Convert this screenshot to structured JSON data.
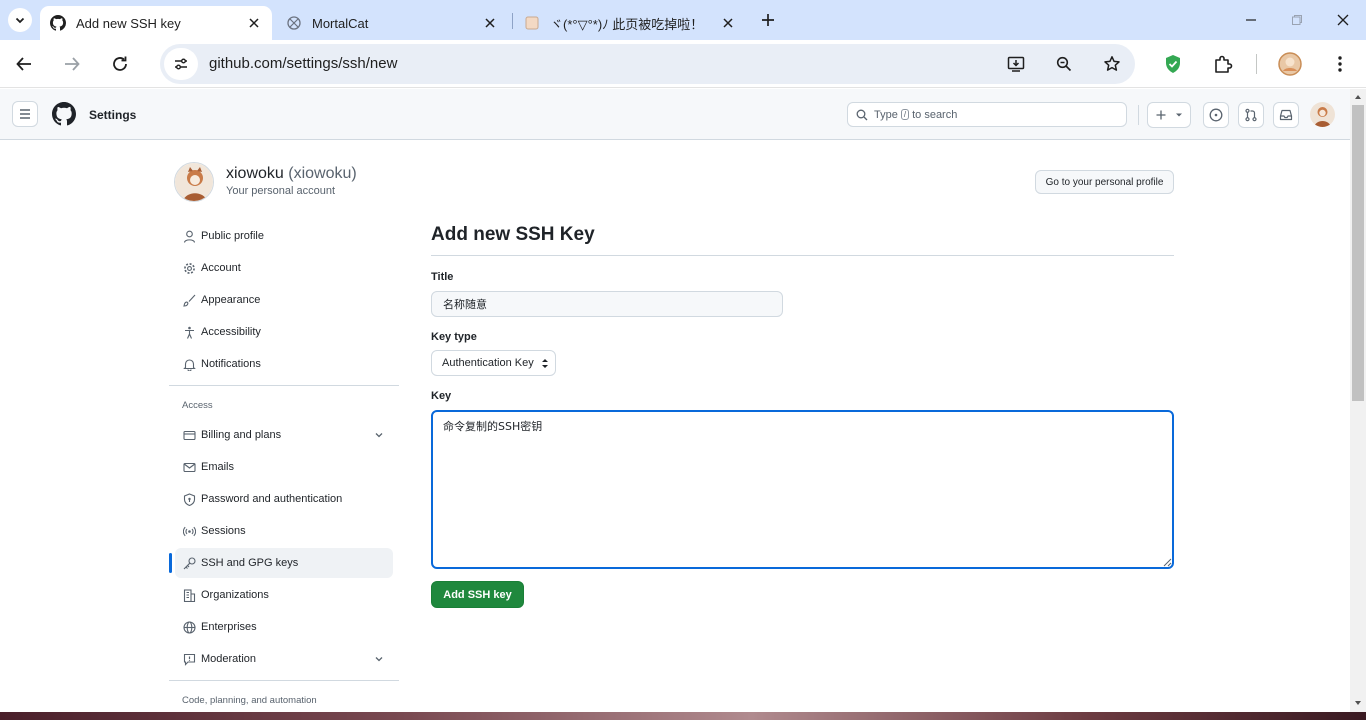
{
  "browser": {
    "tabs": [
      {
        "title": "Add new SSH key",
        "active": true
      },
      {
        "title": "MortalCat",
        "active": false
      },
      {
        "title": "ヾ(*°▽°*)ﾉ 此页被吃掉啦！",
        "active": false
      }
    ],
    "url": "github.com/settings/ssh/new"
  },
  "header": {
    "context": "Settings",
    "search_prefix": "Type",
    "search_kbd": "/",
    "search_suffix": "to search"
  },
  "account": {
    "display_name": "xiowoku",
    "handle": "(xiowoku)",
    "subtitle": "Your personal account",
    "profile_button": "Go to your personal profile"
  },
  "sidebar": {
    "items": [
      {
        "label": "Public profile",
        "icon": "person-icon"
      },
      {
        "label": "Account",
        "icon": "gear-icon"
      },
      {
        "label": "Appearance",
        "icon": "paintbrush-icon"
      },
      {
        "label": "Accessibility",
        "icon": "accessibility-icon"
      },
      {
        "label": "Notifications",
        "icon": "bell-icon"
      }
    ],
    "access_heading": "Access",
    "access_items": [
      {
        "label": "Billing and plans",
        "icon": "credit-card-icon",
        "expandable": true
      },
      {
        "label": "Emails",
        "icon": "mail-icon"
      },
      {
        "label": "Password and authentication",
        "icon": "shield-lock-icon"
      },
      {
        "label": "Sessions",
        "icon": "broadcast-icon"
      },
      {
        "label": "SSH and GPG keys",
        "icon": "key-icon",
        "selected": true
      },
      {
        "label": "Organizations",
        "icon": "organization-icon"
      },
      {
        "label": "Enterprises",
        "icon": "globe-icon"
      },
      {
        "label": "Moderation",
        "icon": "report-icon",
        "expandable": true
      }
    ],
    "code_heading": "Code, planning, and automation"
  },
  "form": {
    "page_title": "Add new SSH Key",
    "title_label": "Title",
    "title_value": "名称随意",
    "key_type_label": "Key type",
    "key_type_value": "Authentication Key",
    "key_label": "Key",
    "key_value": "命令复制的SSH密钥",
    "submit_label": "Add SSH key"
  },
  "colors": {
    "accent": "#0969da",
    "primary_button": "#1f883d",
    "tabbar": "#d3e3fd"
  }
}
